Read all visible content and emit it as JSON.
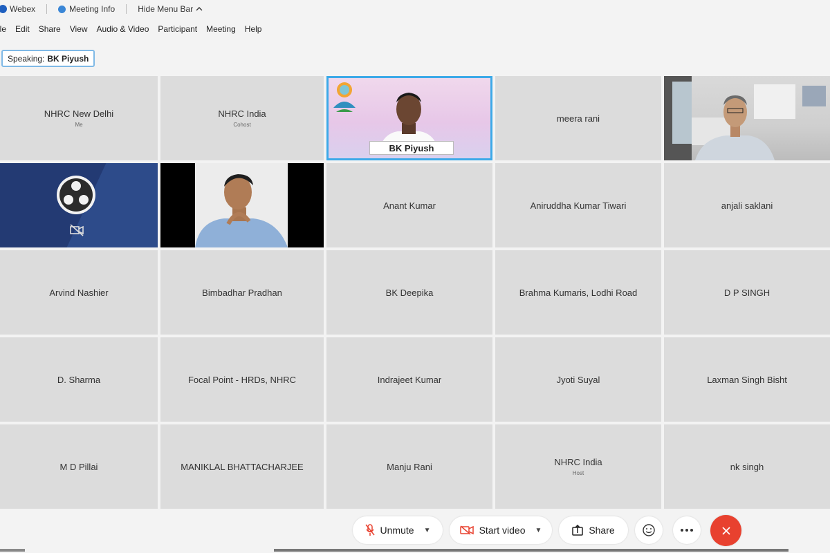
{
  "titlebar": {
    "app_name": "Webex",
    "meeting_info": "Meeting Info",
    "hide_menu": "Hide Menu Bar"
  },
  "menu": [
    "ile",
    "Edit",
    "Share",
    "View",
    "Audio & Video",
    "Participant",
    "Meeting",
    "Help"
  ],
  "speaking": {
    "label": "Speaking:",
    "name": "BK Piyush"
  },
  "active_speaker": "BK Piyush",
  "tiles": [
    {
      "name": "NHRC New Delhi",
      "role": "Me"
    },
    {
      "name": "NHRC India",
      "role": "Cohost"
    },
    {
      "name": "BK Piyush",
      "role": ""
    },
    {
      "name": "meera rani",
      "role": ""
    },
    {
      "name": "",
      "role": ""
    },
    {
      "name": "",
      "role": ""
    },
    {
      "name": "",
      "role": ""
    },
    {
      "name": "Anant Kumar",
      "role": ""
    },
    {
      "name": "Aniruddha Kumar Tiwari",
      "role": ""
    },
    {
      "name": "anjali saklani",
      "role": ""
    },
    {
      "name": "Arvind Nashier",
      "role": ""
    },
    {
      "name": "Bimbadhar Pradhan",
      "role": ""
    },
    {
      "name": "BK Deepika",
      "role": ""
    },
    {
      "name": "Brahma Kumaris, Lodhi Road",
      "role": ""
    },
    {
      "name": "D P SINGH",
      "role": ""
    },
    {
      "name": "D. Sharma",
      "role": ""
    },
    {
      "name": "Focal Point - HRDs, NHRC",
      "role": ""
    },
    {
      "name": "Indrajeet Kumar",
      "role": ""
    },
    {
      "name": "Jyoti Suyal",
      "role": ""
    },
    {
      "name": "Laxman Singh Bisht",
      "role": ""
    },
    {
      "name": "M D Pillai",
      "role": ""
    },
    {
      "name": "MANIKLAL BHATTACHARJEE",
      "role": ""
    },
    {
      "name": "Manju Rani",
      "role": ""
    },
    {
      "name": "NHRC India",
      "role": "Host"
    },
    {
      "name": "nk singh",
      "role": ""
    }
  ],
  "toolbar": {
    "unmute": "Unmute",
    "start_video": "Start video",
    "share": "Share"
  },
  "colors": {
    "active_outline": "#3ca9e8",
    "leave": "#e8412f",
    "tile_bg": "#dcdcdc"
  }
}
